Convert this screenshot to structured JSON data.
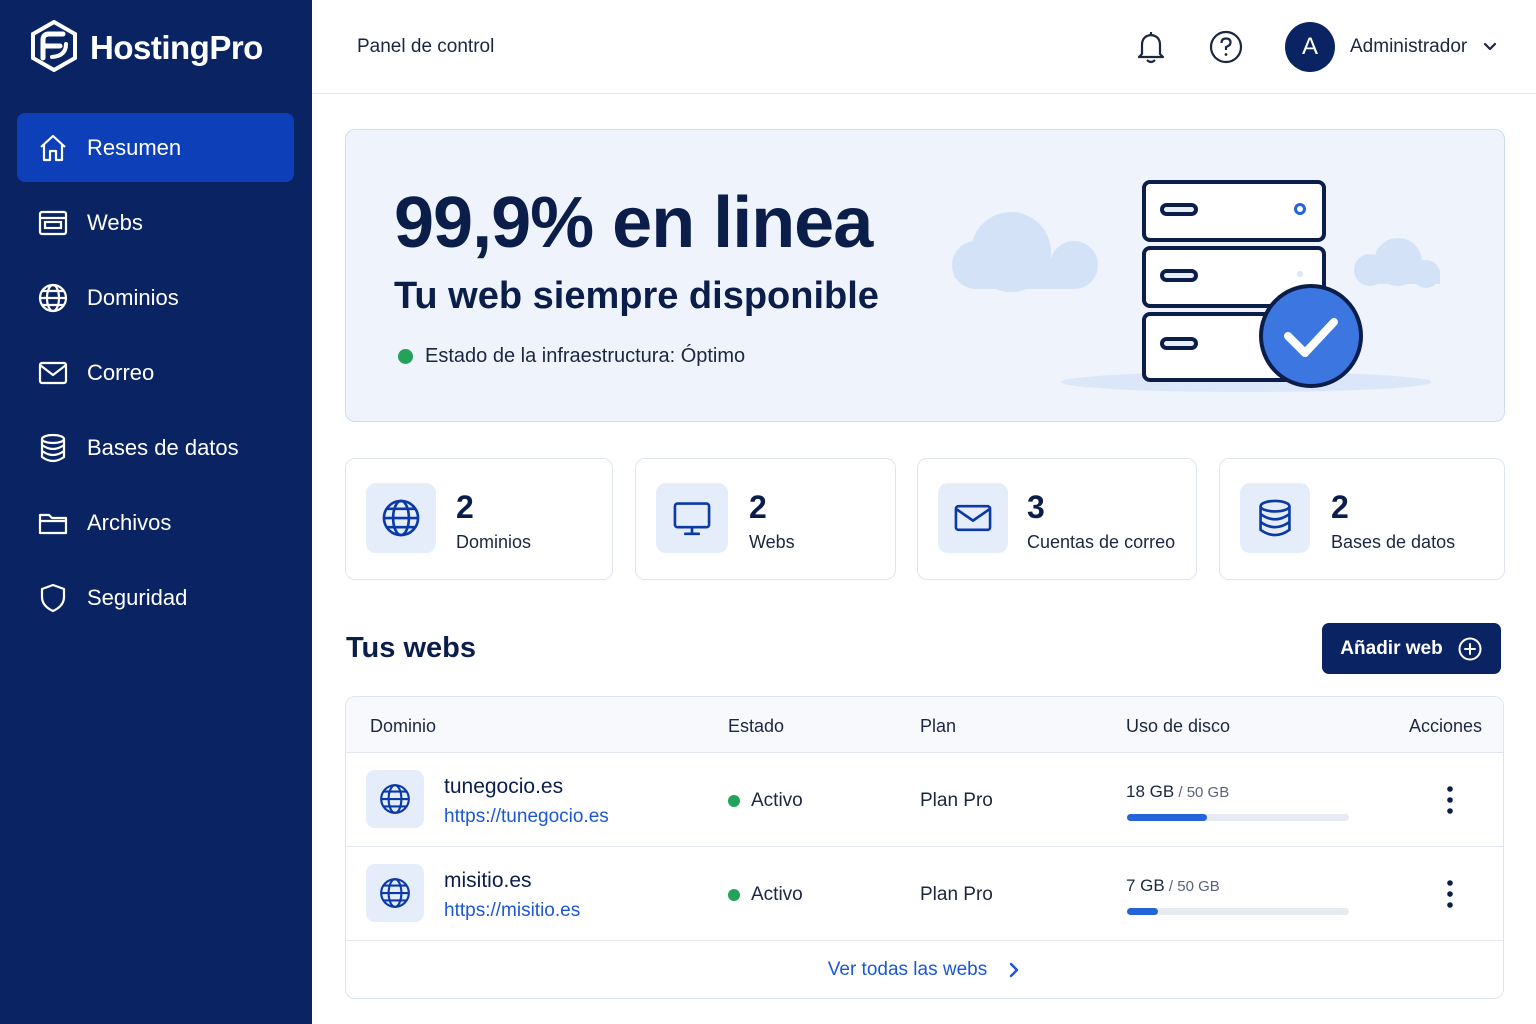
{
  "brand": {
    "name": "HostingPro"
  },
  "sidebar": {
    "items": [
      {
        "label": "Resumen",
        "icon": "home-icon",
        "active": true
      },
      {
        "label": "Webs",
        "icon": "browser-window-icon"
      },
      {
        "label": "Dominios",
        "icon": "globe-icon"
      },
      {
        "label": "Correo",
        "icon": "mail-icon"
      },
      {
        "label": "Bases de datos",
        "icon": "database-icon"
      },
      {
        "label": "Archivos",
        "icon": "folder-icon"
      },
      {
        "label": "Seguridad",
        "icon": "shield-icon"
      }
    ]
  },
  "header": {
    "title": "Panel de control",
    "avatar_initial": "A",
    "user_name": "Administrador"
  },
  "hero": {
    "big": "99,9% en linea",
    "subtitle": "Tu web siempre disponible",
    "status": "Estado de la infraestructura: Óptimo"
  },
  "stats": [
    {
      "value": "2",
      "label": "Dominios",
      "icon": "globe-icon"
    },
    {
      "value": "2",
      "label": "Webs",
      "icon": "monitor-icon"
    },
    {
      "value": "3",
      "label": "Cuentas de correo",
      "icon": "mail-icon"
    },
    {
      "value": "2",
      "label": "Bases de datos",
      "icon": "database-icon"
    }
  ],
  "sites": {
    "title": "Tus webs",
    "add_label": "Añadir web",
    "columns": [
      "Dominio",
      "Estado",
      "Plan",
      "Uso de disco",
      "Acciones"
    ],
    "rows": [
      {
        "domain": "tunegocio.es",
        "url": "https://tunegocio.es",
        "status": "Activo",
        "plan": "Plan Pro",
        "disk_used": "18 GB",
        "disk_total": " / 50 GB",
        "disk_fraction": 0.36
      },
      {
        "domain": "misitio.es",
        "url": "https://misitio.es",
        "status": "Activo",
        "plan": "Plan Pro",
        "disk_used": "7 GB",
        "disk_total": " / 50 GB",
        "disk_fraction": 0.14
      }
    ],
    "view_all": "Ver todas las webs"
  },
  "colors": {
    "sidebar": "#0a2463",
    "active_nav": "#0d3fb8",
    "accent_blue": "#2563d9",
    "status_green": "#22a25b"
  }
}
